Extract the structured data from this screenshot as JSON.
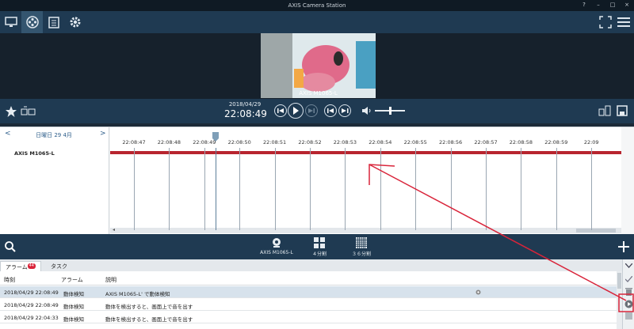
{
  "window": {
    "title": "AXIS Camera Station",
    "controls": [
      "?",
      "–",
      "□",
      "×"
    ]
  },
  "video": {
    "camera_caption": "AXIS M1065-L"
  },
  "playback": {
    "date": "2018/04/29",
    "time": "22:08:49"
  },
  "timeline": {
    "day_label": "日曜日 29 4月",
    "prev": "<",
    "next": ">",
    "camera": "AXIS M1065-L",
    "ticks": [
      "22:08:47",
      "22:08:48",
      "22:08:49",
      "22:08:50",
      "22:08:51",
      "22:08:52",
      "22:08:53",
      "22:08:54",
      "22:08:55",
      "22:08:56",
      "22:08:57",
      "22:08:58",
      "22:08:59",
      "22:09"
    ]
  },
  "bottom_bar": {
    "camera": "AXIS M1065-L",
    "split4": "４分割",
    "split36": "３６分割"
  },
  "tabs": [
    {
      "label": "アラーム",
      "badge": "44"
    },
    {
      "label": "タスク"
    }
  ],
  "alarm_table": {
    "headers": [
      "時刻",
      "アラーム",
      "説明"
    ],
    "rows": [
      {
        "time": "2018/04/29 22:08:49",
        "alarm": "動体検知",
        "desc": "AXIS M1065-L' で動体検知"
      },
      {
        "time": "2018/04/29 22:08:49",
        "alarm": "動体検知",
        "desc": "動体を検出すると、画面上で音を出す"
      },
      {
        "time": "2018/04/29 22:04:33",
        "alarm": "動体検知",
        "desc": "動体を検出すると、画面上で音を出す"
      }
    ]
  },
  "colors": {
    "toolbar": "#1f3a52",
    "recording": "#b8252f",
    "annotation": "#d9243a"
  }
}
